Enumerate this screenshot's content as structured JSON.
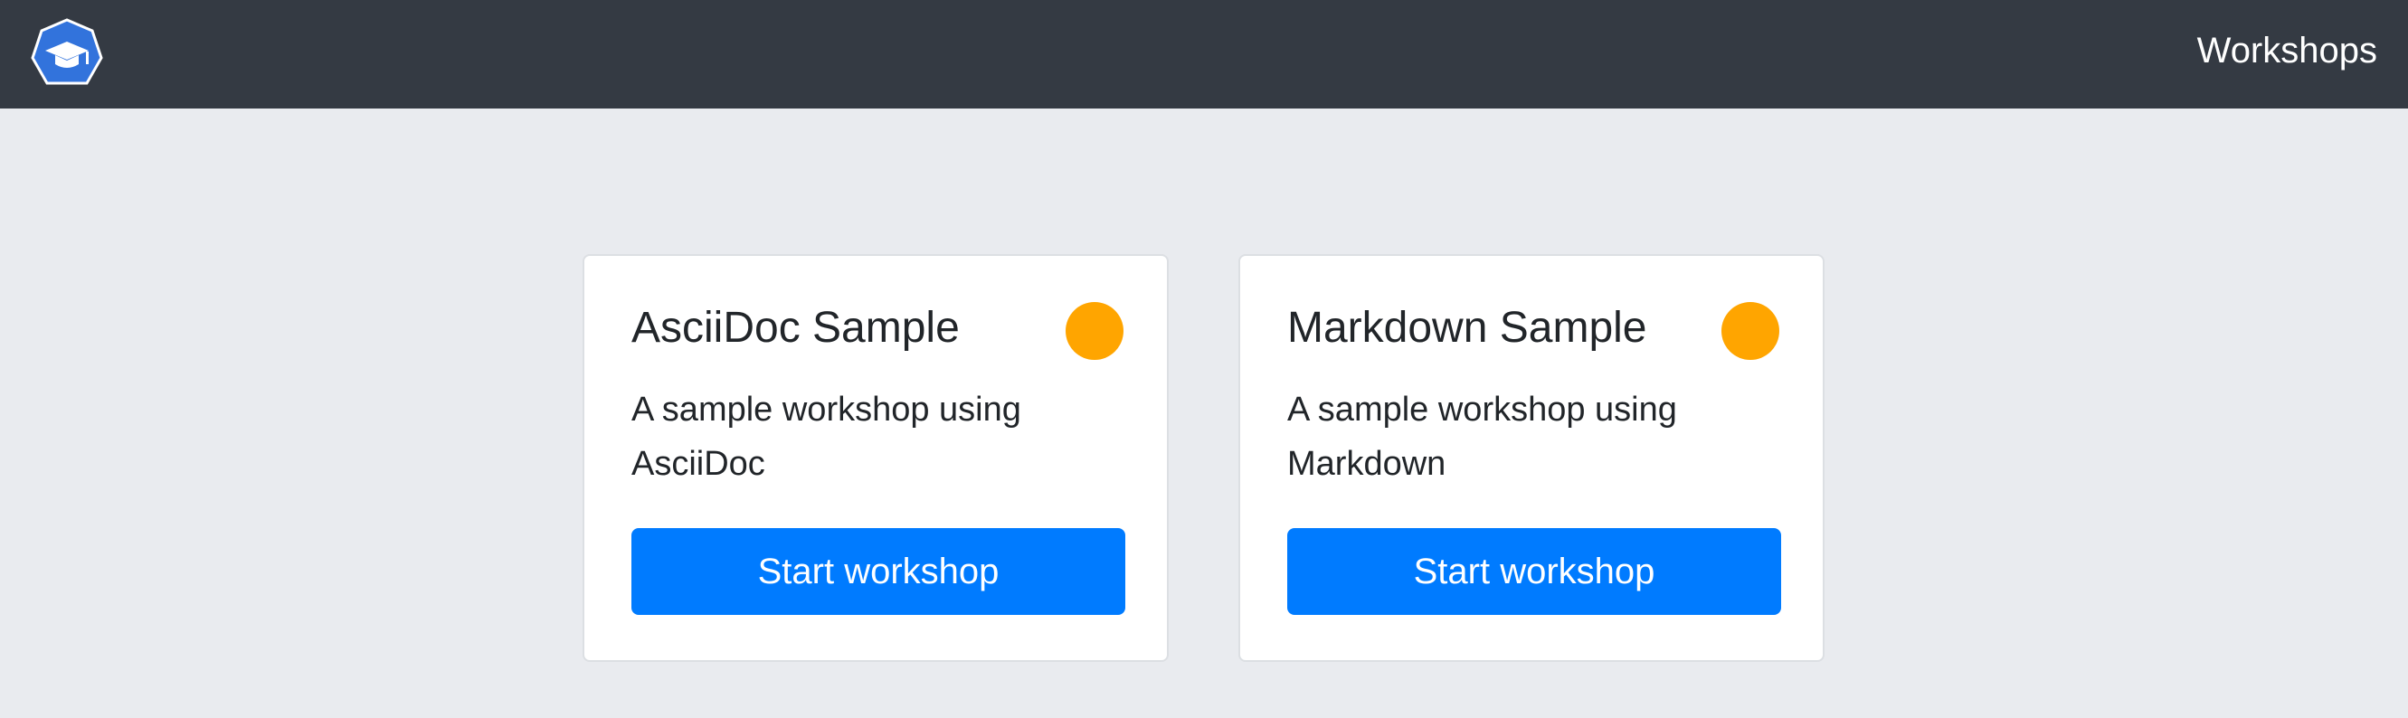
{
  "colors": {
    "navbar": "#343a43",
    "page_background": "#e9ebef",
    "primary_button": "#007bff",
    "status_dot": "#ffa500",
    "logo": "#3273dc"
  },
  "header": {
    "logo_icon": "graduation-cap-icon",
    "title": "Workshops"
  },
  "workshops": [
    {
      "title": "AsciiDoc Sample",
      "description": "A sample workshop using AsciiDoc",
      "status_icon": "status-dot-icon",
      "button_label": "Start workshop"
    },
    {
      "title": "Markdown Sample",
      "description": "A sample workshop using Markdown",
      "status_icon": "status-dot-icon",
      "button_label": "Start workshop"
    }
  ]
}
